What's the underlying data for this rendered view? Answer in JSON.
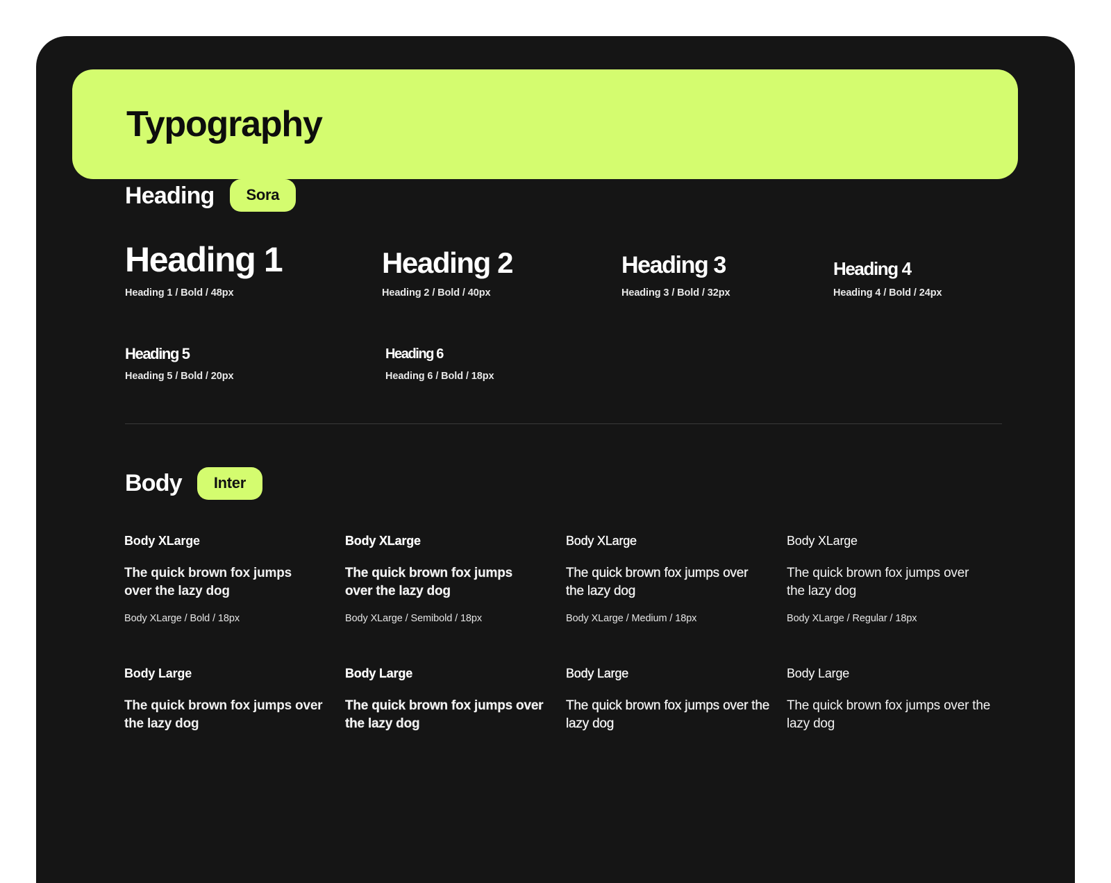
{
  "banner": {
    "title": "Typography",
    "background_color": "#d4fc6f",
    "text_color": "#0d0d0d"
  },
  "theme": {
    "page_background": "#ffffff",
    "card_background": "#151515",
    "accent": "#d4fc6f",
    "text_primary": "#ffffff",
    "divider": "#3a3a3a"
  },
  "heading_section": {
    "title": "Heading",
    "font_pill": "Sora",
    "rows": [
      [
        {
          "specimen": "Heading 1",
          "caption": "Heading 1 / Bold / 48px",
          "size": "48px",
          "weight": "Bold"
        },
        {
          "specimen": "Heading 2",
          "caption": "Heading 2 / Bold / 40px",
          "size": "40px",
          "weight": "Bold"
        },
        {
          "specimen": "Heading 3",
          "caption": "Heading 3 / Bold / 32px",
          "size": "32px",
          "weight": "Bold"
        },
        {
          "specimen": "Heading 4",
          "caption": "Heading 4 / Bold / 24px",
          "size": "24px",
          "weight": "Bold"
        }
      ],
      [
        {
          "specimen": "Heading 5",
          "caption": "Heading 5 / Bold / 20px",
          "size": "20px",
          "weight": "Bold"
        },
        {
          "specimen": "Heading 6",
          "caption": "Heading 6 / Bold / 18px",
          "size": "18px",
          "weight": "Bold"
        }
      ]
    ]
  },
  "body_section": {
    "title": "Body",
    "font_pill": "Inter",
    "rows": [
      {
        "name": "Body XLarge",
        "cells": [
          {
            "label": "Body XLarge",
            "sample": "The quick brown fox jumps over the lazy dog",
            "caption": "Body XLarge / Bold / 18px",
            "weight": "Bold"
          },
          {
            "label": "Body XLarge",
            "sample": "The quick brown fox jumps over the lazy dog",
            "caption": "Body XLarge / Semibold / 18px",
            "weight": "Semibold"
          },
          {
            "label": "Body XLarge",
            "sample": "The quick brown fox jumps over the lazy dog",
            "caption": "Body XLarge / Medium / 18px",
            "weight": "Medium"
          },
          {
            "label": "Body XLarge",
            "sample": "The quick brown fox jumps over the lazy dog",
            "caption": "Body XLarge / Regular / 18px",
            "weight": "Regular"
          }
        ]
      },
      {
        "name": "Body Large",
        "cells": [
          {
            "label": "Body Large",
            "sample": "The quick brown fox jumps over the lazy dog",
            "caption": "",
            "weight": "Bold"
          },
          {
            "label": "Body Large",
            "sample": "The quick brown fox jumps over the lazy dog",
            "caption": "",
            "weight": "Semibold"
          },
          {
            "label": "Body Large",
            "sample": "The quick brown fox jumps over the lazy dog",
            "caption": "",
            "weight": "Medium"
          },
          {
            "label": "Body Large",
            "sample": "The quick brown fox jumps over the lazy dog",
            "caption": "",
            "weight": "Regular"
          }
        ]
      }
    ]
  }
}
